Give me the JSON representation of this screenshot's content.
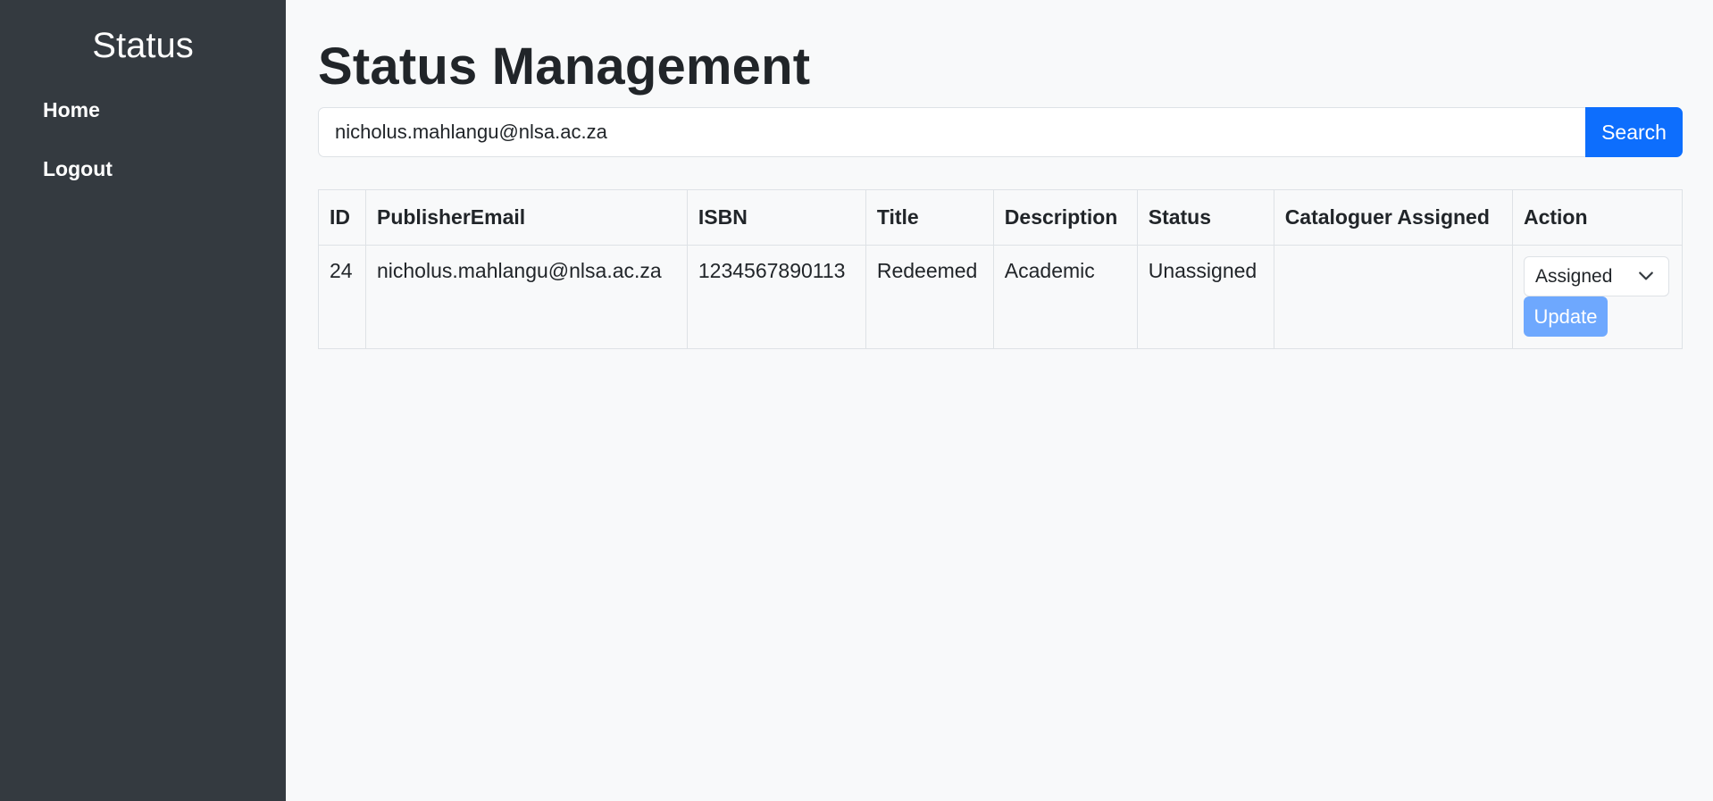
{
  "sidebar": {
    "title": "Status",
    "items": [
      {
        "label": "Home"
      },
      {
        "label": "Logout"
      }
    ]
  },
  "main": {
    "title": "Status Management",
    "search": {
      "value": "nicholus.mahlangu@nlsa.ac.za",
      "button_label": "Search"
    },
    "table": {
      "headers": [
        "ID",
        "PublisherEmail",
        "ISBN",
        "Title",
        "Description",
        "Status",
        "Cataloguer Assigned",
        "Action"
      ],
      "rows": [
        {
          "id": "24",
          "publisher_email": "nicholus.mahlangu@nlsa.ac.za",
          "isbn": "1234567890113",
          "title": "Redeemed",
          "description": "Academic",
          "status": "Unassigned",
          "cataloguer_assigned": "",
          "action": {
            "select_value": "Assigned",
            "update_label": "Update"
          }
        }
      ]
    }
  },
  "colors": {
    "sidebar_bg": "#343a40",
    "page_bg": "#f8f9fa",
    "primary": "#0d6efd",
    "update_button": "#6ea8fe"
  },
  "icons": {
    "select_chevron": "chevron-down-icon"
  }
}
